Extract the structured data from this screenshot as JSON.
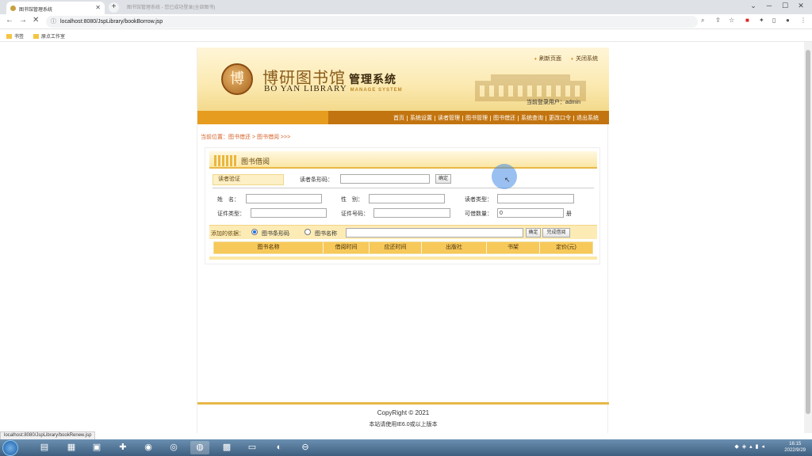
{
  "browser": {
    "tab_title": "图书馆管理系统",
    "ghost_tab": "图书馆管理系统 - 您已成功登录(全部图书)",
    "url": "localhost:8080/JspLibrary/bookBorrow.jsp",
    "bookmarks": [
      "书签",
      "原点工作室"
    ],
    "status_url": "localhost:8080/JspLibrary/bookRenew.jsp"
  },
  "header": {
    "logo_seal": "博",
    "logo_cn": "博研图书馆",
    "logo_cn_suffix": "管理系统",
    "logo_en": "BO YAN LIBRARY",
    "logo_en_suffix": "MANAGE SYSTEM",
    "refresh_link": "刷新页面",
    "close_link": "关闭系统",
    "current_user": "当前登录用户：admin"
  },
  "nav": {
    "items": [
      "首页",
      "系统设置",
      "读者管理",
      "图书管理",
      "图书借还",
      "系统查询",
      "更改口令",
      "退出系统"
    ]
  },
  "breadcrumb": "当前位置：图书借还 > 图书借阅 >>>",
  "panel": {
    "title": "图书借阅",
    "verify_label": "读者验证",
    "barcode_label": "读者条形码：",
    "barcode_value": "",
    "confirm_btn": "确定",
    "name_label": "姓　名：",
    "gender_label": "性　别：",
    "reader_type_label": "读者类型：",
    "id_type_label": "证件类型：",
    "id_number_label": "证件号码：",
    "borrowable_label": "可借数量：",
    "borrowable_value": "0",
    "unit": "册",
    "add_basis_label": "添加的依据：",
    "radio_barcode": "图书条形码",
    "radio_name": "图书名称",
    "add_confirm_btn": "确定",
    "finish_btn": "完成借阅",
    "columns": [
      "图书名称",
      "借阅时间",
      "应还时间",
      "出版社",
      "书架",
      "定价(元)"
    ]
  },
  "footer": {
    "copyright": "CopyRight © 2021",
    "browser_note": "本站请使用IE6.0或以上版本"
  },
  "taskbar": {
    "time": "16:15",
    "date": "2022/9/29"
  }
}
